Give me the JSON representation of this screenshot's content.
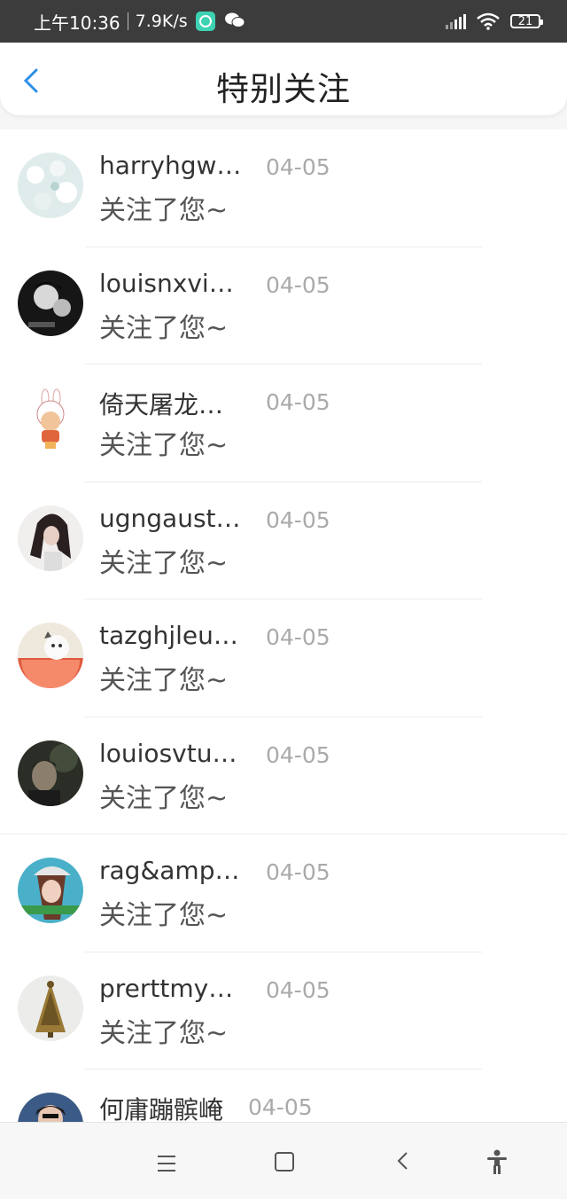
{
  "status_bar": {
    "time": "上午10:36",
    "speed": "7.9K/s",
    "battery": "21"
  },
  "header": {
    "title": "特别关注"
  },
  "items": [
    {
      "name": "harryhgw…",
      "date": "04-05",
      "message": "关注了您~"
    },
    {
      "name": "louisnxvi…",
      "date": "04-05",
      "message": "关注了您~"
    },
    {
      "name": "倚天屠龙…",
      "date": "04-05",
      "message": "关注了您~"
    },
    {
      "name": "ugngaust…",
      "date": "04-05",
      "message": "关注了您~"
    },
    {
      "name": "tazghjleu…",
      "date": "04-05",
      "message": "关注了您~"
    },
    {
      "name": "louiosvtu…",
      "date": "04-05",
      "message": "关注了您~"
    },
    {
      "name": "rag&amp…",
      "date": "04-05",
      "message": "关注了您~"
    },
    {
      "name": "prerttmy…",
      "date": "04-05",
      "message": "关注了您~"
    },
    {
      "name": "何庸蹦髌崦",
      "date": "04-05",
      "message": ""
    }
  ],
  "colors": {
    "accent": "#2f8fe8",
    "status_bar_bg": "#3c3c3c"
  }
}
